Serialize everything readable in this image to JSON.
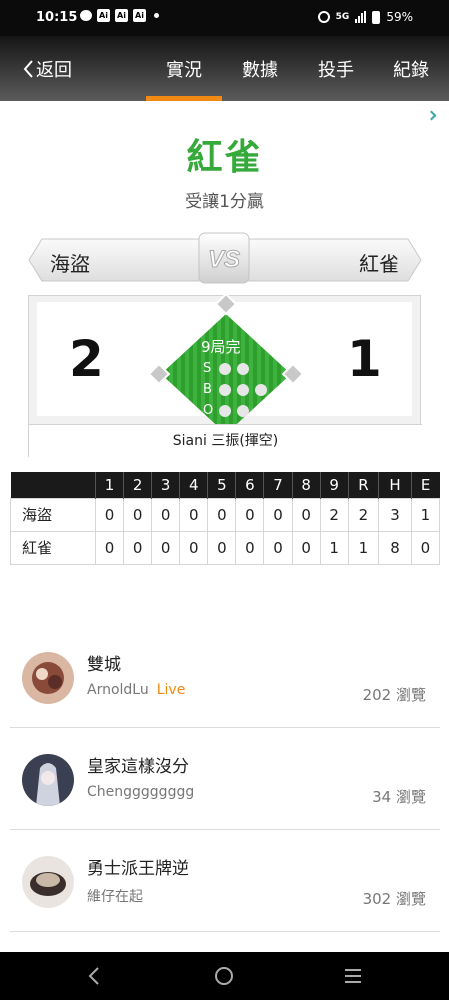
{
  "status_bar": {
    "time": "10:15",
    "notif_icons": [
      "Ai",
      "Ai",
      "Ai"
    ],
    "network": "5G",
    "battery": "59%"
  },
  "header": {
    "back_label": "返回",
    "tabs": [
      {
        "label": "實況",
        "active": true
      },
      {
        "label": "數據",
        "active": false
      },
      {
        "label": "投手",
        "active": false
      },
      {
        "label": "紀錄",
        "active": false
      }
    ],
    "accent_color": "#f08a12"
  },
  "result": {
    "winner": "紅雀",
    "subtitle": "受讓1分贏",
    "winner_color": "#35a93a"
  },
  "matchup": {
    "away_team": "海盜",
    "home_team": "紅雀",
    "vs_label": "VS",
    "away_score": "2",
    "home_score": "1",
    "inning": "9局完",
    "count_labels": [
      "S",
      "B",
      "O"
    ],
    "last_play": "Siani 三振(揮空)"
  },
  "linescore": {
    "headers": [
      "",
      "1",
      "2",
      "3",
      "4",
      "5",
      "6",
      "7",
      "8",
      "9",
      "R",
      "H",
      "E"
    ],
    "rows": [
      {
        "team": "海盜",
        "cells": [
          "0",
          "0",
          "0",
          "0",
          "0",
          "0",
          "0",
          "0",
          "2",
          "2",
          "3",
          "1"
        ]
      },
      {
        "team": "紅雀",
        "cells": [
          "0",
          "0",
          "0",
          "0",
          "0",
          "0",
          "0",
          "0",
          "1",
          "1",
          "8",
          "0"
        ]
      }
    ]
  },
  "posts": [
    {
      "title": "雙城",
      "author": "ArnoldLu",
      "badge": "Live",
      "views": "202 瀏覽"
    },
    {
      "title": "皇家這樣沒分",
      "author": "Chengggggggg",
      "badge": "",
      "views": "34 瀏覽"
    },
    {
      "title": "勇士派王牌逆",
      "author": "維仔在起",
      "badge": "",
      "views": "302 瀏覽"
    }
  ]
}
